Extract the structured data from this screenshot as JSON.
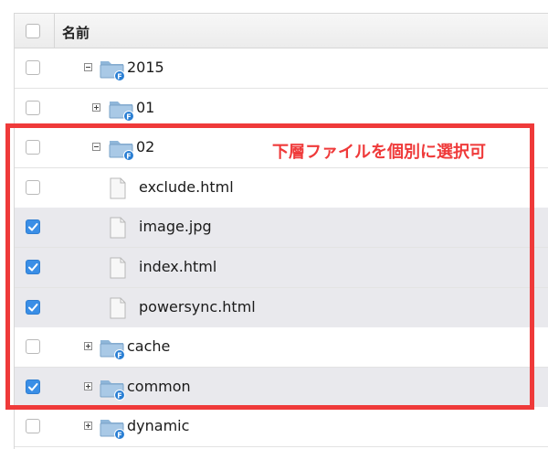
{
  "header": {
    "title": "名前"
  },
  "rows": [
    {
      "label": "2015",
      "checked": false,
      "kind": "folder",
      "toggle": "minus",
      "depth": 0
    },
    {
      "label": "01",
      "checked": false,
      "kind": "folder",
      "toggle": "plus",
      "depth": 1
    },
    {
      "label": "02",
      "checked": false,
      "kind": "folder",
      "toggle": "minus",
      "depth": 1
    },
    {
      "label": "exclude.html",
      "checked": false,
      "kind": "file",
      "depth": 2
    },
    {
      "label": "image.jpg",
      "checked": true,
      "kind": "file",
      "depth": 2
    },
    {
      "label": "index.html",
      "checked": true,
      "kind": "file",
      "depth": 2
    },
    {
      "label": "powersync.html",
      "checked": true,
      "kind": "file",
      "depth": 2
    },
    {
      "label": "cache",
      "checked": false,
      "kind": "folder",
      "toggle": "plus",
      "depth": 0
    },
    {
      "label": "common",
      "checked": true,
      "kind": "folder",
      "toggle": "plus",
      "depth": 0
    },
    {
      "label": "dynamic",
      "checked": false,
      "kind": "folder",
      "toggle": "plus",
      "depth": 0
    }
  ],
  "annotation": {
    "text": "下層ファイルを個別に選択可"
  },
  "colors": {
    "checkbox_checked": "#3a8ee6",
    "selected_row": "#e9e9ed",
    "annotation": "#ef3a3a",
    "folder_badge": "#2a7fd4"
  },
  "icons": {
    "folder": "folder-icon",
    "file": "file-icon",
    "expand": "plus-box-icon",
    "collapse": "minus-box-icon",
    "check": "checkmark-icon"
  }
}
